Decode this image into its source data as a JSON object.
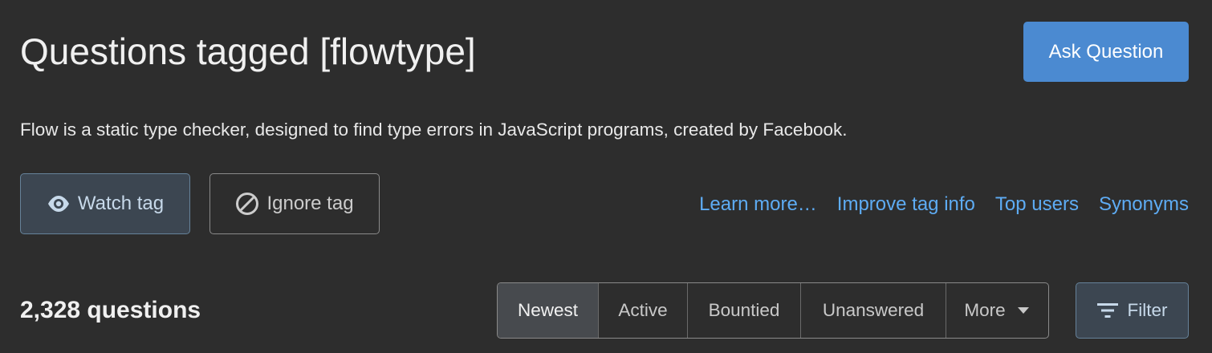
{
  "header": {
    "title": "Questions tagged [flowtype]",
    "ask_button_label": "Ask Question"
  },
  "tag": {
    "description": "Flow is a static type checker, designed to find type errors in JavaScript programs, created by Facebook.",
    "watch_label": "Watch tag",
    "watch_icon": "eye-icon",
    "ignore_label": "Ignore tag",
    "ignore_icon": "block-icon",
    "links": [
      {
        "label": "Learn more…"
      },
      {
        "label": "Improve tag info"
      },
      {
        "label": "Top users"
      },
      {
        "label": "Synonyms"
      }
    ]
  },
  "questions": {
    "count_label": "2,328 questions",
    "sort_tabs": [
      {
        "label": "Newest",
        "active": true
      },
      {
        "label": "Active",
        "active": false
      },
      {
        "label": "Bountied",
        "active": false
      },
      {
        "label": "Unanswered",
        "active": false
      },
      {
        "label": "More",
        "active": false
      }
    ],
    "filter_label": "Filter",
    "filter_icon": "filter-icon"
  },
  "colors": {
    "background": "#2d2d2d",
    "primary_button": "#4b8ad1",
    "link": "#5eacf4",
    "muted_button_bg": "#3c4651",
    "muted_button_border": "#66829a"
  }
}
